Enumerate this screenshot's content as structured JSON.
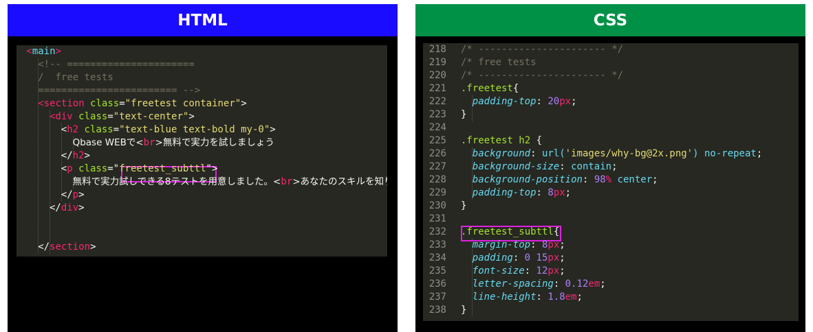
{
  "html_panel": {
    "title": "HTML",
    "header_color": "#1a0cff",
    "lines": [
      [
        [
          "tag",
          "<"
        ],
        [
          "kw",
          "main"
        ],
        [
          "tag",
          ">"
        ]
      ],
      [
        [
          "cmt",
          "<!-- ======================"
        ]
      ],
      [
        [
          "cmt",
          "/  free tests"
        ]
      ],
      [
        [
          "cmt",
          "======================== -->"
        ]
      ],
      [
        [
          "tag",
          "<section "
        ],
        [
          "attr",
          "class"
        ],
        [
          "plain",
          "="
        ],
        [
          "str",
          "\"freetest container\""
        ],
        [
          "plain",
          ">"
        ]
      ],
      [
        [
          "tag",
          "<div "
        ],
        [
          "attr",
          "class"
        ],
        [
          "plain",
          "="
        ],
        [
          "str",
          "\"text-center\""
        ],
        [
          "plain",
          ">"
        ]
      ],
      [
        [
          "plain",
          "<"
        ],
        [
          "tag",
          "h2 "
        ],
        [
          "attr",
          "class"
        ],
        [
          "plain",
          "="
        ],
        [
          "str",
          "\"text-blue text-bold my-0\""
        ],
        [
          "plain",
          ">"
        ]
      ],
      [
        [
          "txt",
          "Qbase WEBで<"
        ],
        [
          "tag",
          "br"
        ],
        [
          "txt",
          ">無料で実力を試しましょう"
        ]
      ],
      [
        [
          "plain",
          "</"
        ],
        [
          "tag",
          "h2"
        ],
        [
          "plain",
          ">"
        ]
      ],
      [
        [
          "plain",
          "<"
        ],
        [
          "tag",
          "p "
        ],
        [
          "attr",
          "class"
        ],
        [
          "plain",
          "=\""
        ],
        [
          "str",
          "freetest_subttl"
        ],
        [
          "plain",
          "\">"
        ]
      ],
      [
        [
          "txt",
          "無料で実力試しできる8テストを用意しました。<"
        ],
        [
          "tag",
          "br"
        ],
        [
          "txt",
          ">あなたのスキルを知りま"
        ]
      ],
      [
        [
          "plain",
          "</"
        ],
        [
          "tag",
          "p"
        ],
        [
          "plain",
          ">"
        ]
      ],
      [
        [
          "plain",
          "</"
        ],
        [
          "tag",
          "div"
        ],
        [
          "plain",
          ">"
        ]
      ],
      [],
      [],
      [
        [
          "plain",
          "</"
        ],
        [
          "tag",
          "section"
        ],
        [
          "plain",
          ">"
        ]
      ]
    ]
  },
  "css_panel": {
    "title": "CSS",
    "header_color": "#009147",
    "line_numbers": [
      "218",
      "219",
      "220",
      "221",
      "222",
      "223",
      "224",
      "225",
      "226",
      "227",
      "228",
      "229",
      "230",
      "231",
      "232",
      "233",
      "234",
      "235",
      "236",
      "237",
      "238"
    ],
    "lines": [
      [
        [
          "cmt",
          "/* ---------------------- */"
        ]
      ],
      [
        [
          "cmt",
          "/* free tests"
        ]
      ],
      [
        [
          "cmt",
          "/* ---------------------- */"
        ]
      ],
      [
        [
          "sel",
          ".freetest"
        ],
        [
          "plain",
          "{"
        ]
      ],
      [
        [
          "prop",
          "padding-top"
        ],
        [
          "plain",
          ": "
        ],
        [
          "num",
          "20"
        ],
        [
          "unit",
          "px"
        ],
        [
          "plain",
          ";"
        ]
      ],
      [
        [
          "plain",
          "}"
        ]
      ],
      [],
      [
        [
          "sel",
          ".freetest h2 "
        ],
        [
          "plain",
          "{"
        ]
      ],
      [
        [
          "prop",
          "background"
        ],
        [
          "plain",
          ": "
        ],
        [
          "kw",
          "url("
        ],
        [
          "str",
          "'images/why-bg@2x.png'"
        ],
        [
          "kw",
          ")"
        ],
        [
          "plain",
          " "
        ],
        [
          "kw",
          "no-repeat"
        ],
        [
          "plain",
          ";"
        ]
      ],
      [
        [
          "prop",
          "background-size"
        ],
        [
          "plain",
          ": "
        ],
        [
          "kw",
          "contain"
        ],
        [
          "plain",
          ";"
        ]
      ],
      [
        [
          "prop",
          "background-position"
        ],
        [
          "plain",
          ": "
        ],
        [
          "num",
          "98"
        ],
        [
          "unit",
          "%"
        ],
        [
          "plain",
          " "
        ],
        [
          "kw",
          "center"
        ],
        [
          "plain",
          ";"
        ]
      ],
      [
        [
          "prop",
          "padding-top"
        ],
        [
          "plain",
          ": "
        ],
        [
          "num",
          "8"
        ],
        [
          "unit",
          "px"
        ],
        [
          "plain",
          ";"
        ]
      ],
      [
        [
          "plain",
          "}"
        ]
      ],
      [],
      [
        [
          "sel",
          ".freetest_subttl"
        ],
        [
          "plain",
          "{"
        ]
      ],
      [
        [
          "prop",
          "margin-top"
        ],
        [
          "plain",
          ": "
        ],
        [
          "num",
          "8"
        ],
        [
          "unit",
          "px"
        ],
        [
          "plain",
          ";"
        ]
      ],
      [
        [
          "prop",
          "padding"
        ],
        [
          "plain",
          ": "
        ],
        [
          "num",
          "0"
        ],
        [
          "plain",
          " "
        ],
        [
          "num",
          "15"
        ],
        [
          "unit",
          "px"
        ],
        [
          "plain",
          ";"
        ]
      ],
      [
        [
          "prop",
          "font-size"
        ],
        [
          "plain",
          ": "
        ],
        [
          "num",
          "12"
        ],
        [
          "unit",
          "px"
        ],
        [
          "plain",
          ";"
        ]
      ],
      [
        [
          "prop",
          "letter-spacing"
        ],
        [
          "plain",
          ": "
        ],
        [
          "num",
          "0.12"
        ],
        [
          "unit",
          "em"
        ],
        [
          "plain",
          ";"
        ]
      ],
      [
        [
          "prop",
          "line-height"
        ],
        [
          "plain",
          ": "
        ],
        [
          "num",
          "1.8"
        ],
        [
          "unit",
          "em"
        ],
        [
          "plain",
          ";"
        ]
      ],
      [
        [
          "plain",
          "}"
        ]
      ]
    ]
  },
  "colors": {
    "code_bg": "#272822",
    "highlight_box": "#e020e0"
  }
}
